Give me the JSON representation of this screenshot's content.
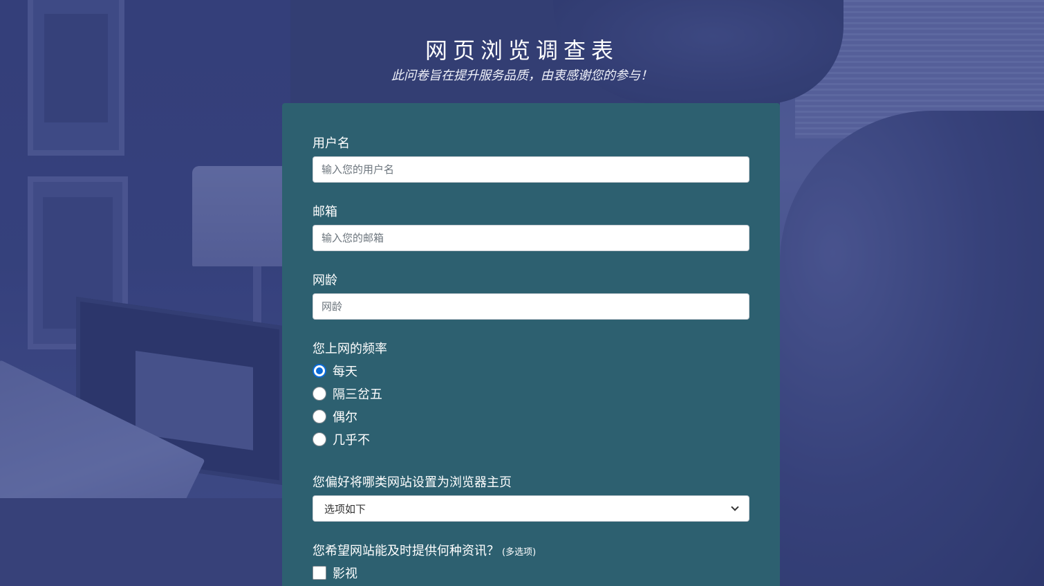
{
  "header": {
    "title": "网页浏览调查表",
    "subtitle": "此问卷旨在提升服务品质，由衷感谢您的参与！"
  },
  "form": {
    "username": {
      "label": "用户名",
      "placeholder": "输入您的用户名"
    },
    "email": {
      "label": "邮箱",
      "placeholder": "输入您的邮箱"
    },
    "age": {
      "label": "网龄",
      "placeholder": "网龄"
    },
    "frequency": {
      "label": "您上网的频率",
      "options": [
        "每天",
        "隔三岔五",
        "偶尔",
        "几乎不"
      ],
      "selected": "每天"
    },
    "homepage": {
      "label": "您偏好将哪类网站设置为浏览器主页",
      "selected": "选项如下"
    },
    "info": {
      "label": "您希望网站能及时提供何种资讯？",
      "note": "(多选项)",
      "options": [
        "影视"
      ]
    }
  },
  "colors": {
    "card_bg": "#2d6070",
    "radio_accent": "#0b6bd8",
    "background": "#3a4677"
  }
}
